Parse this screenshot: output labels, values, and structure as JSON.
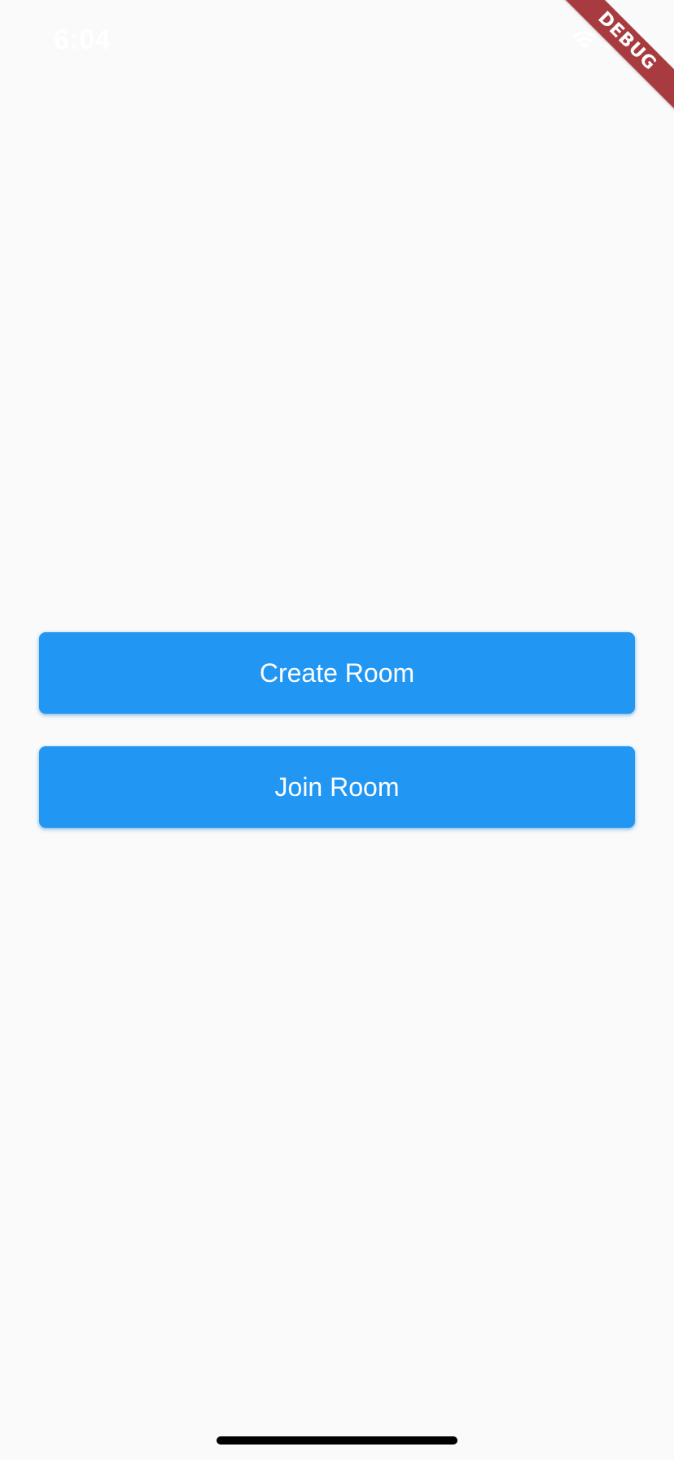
{
  "status_bar": {
    "time": "6:04",
    "wifi_icon": "wifi-icon",
    "battery_icon": "battery-icon"
  },
  "debug_banner": {
    "label": "DEBUG",
    "color": "#a83b3f"
  },
  "buttons": {
    "create_room": "Create Room",
    "join_room": "Join Room",
    "color": "#2196f3",
    "text_color": "#ffffff"
  },
  "home_indicator": {
    "icon": "home-indicator-bar"
  }
}
